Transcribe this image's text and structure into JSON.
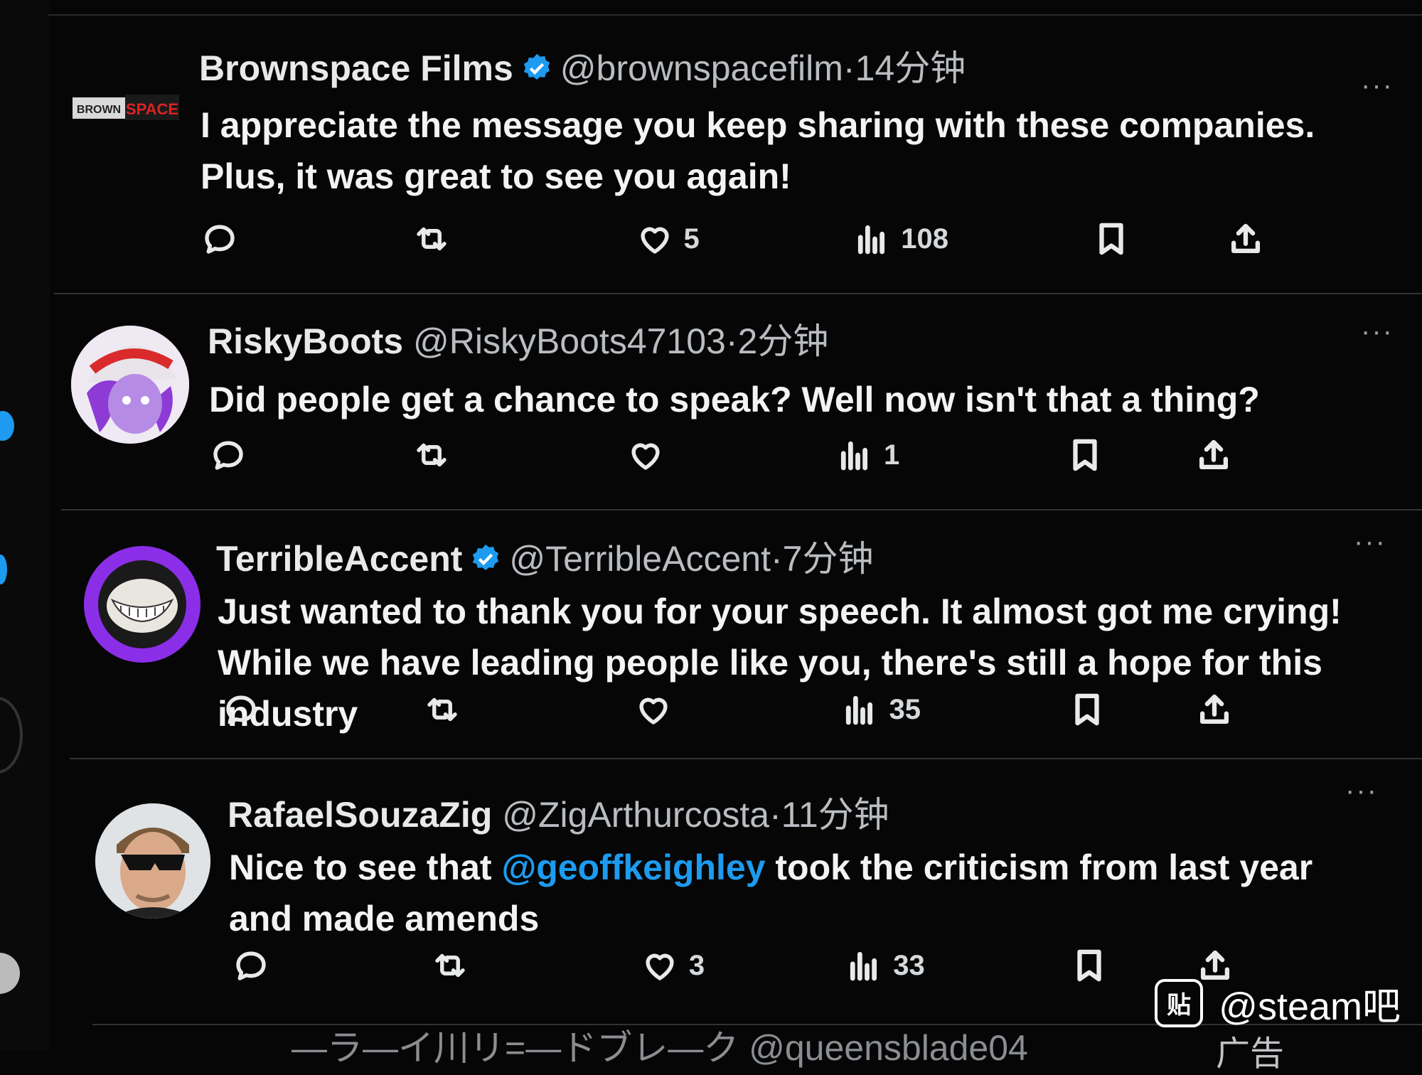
{
  "colors": {
    "background": "#060606",
    "accent": "#1d9bf0",
    "text": "#e7e9ea",
    "muted": "#b9bcc0"
  },
  "tweets": [
    {
      "name": "Brownspace Films",
      "verified": true,
      "handle": "@brownspacefilm",
      "sep": "·",
      "time": "14分钟",
      "avatar_text": "BROWNSPACE",
      "text": "I appreciate the message you keep sharing with these companies. Plus, it was great to see you again!",
      "likes": "5",
      "views": "108"
    },
    {
      "name": "RiskyBoots",
      "verified": false,
      "handle": "@RiskyBoots47103",
      "sep": "·",
      "time": "2分钟",
      "text": "Did people get a chance to speak? Well now isn't that a thing?",
      "likes": "",
      "views": "1"
    },
    {
      "name": "TerribleAccent",
      "verified": true,
      "handle": "@TerribleAccent",
      "sep": "·",
      "time": "7分钟",
      "text": "Just wanted to thank you for your speech. It almost got me crying! While we have leading people like you, there's still a hope for this industry",
      "likes": "",
      "views": "35"
    },
    {
      "name": "RafaelSouzaZig",
      "verified": false,
      "handle": "@ZigArthurcosta",
      "sep": "·",
      "time": "11分钟",
      "text_before": "Nice to see that ",
      "mention": "@geoffkeighley",
      "text_after": " took the criticism from last year and made amends",
      "likes": "3",
      "views": "33"
    }
  ],
  "partial_tweet": {
    "header": "—ラ—イ川リ=—ドブレ—ク @queensblade04",
    "ad": "广告"
  },
  "more_label": "···",
  "watermark": {
    "logo": "贴",
    "text": "@steam吧"
  }
}
